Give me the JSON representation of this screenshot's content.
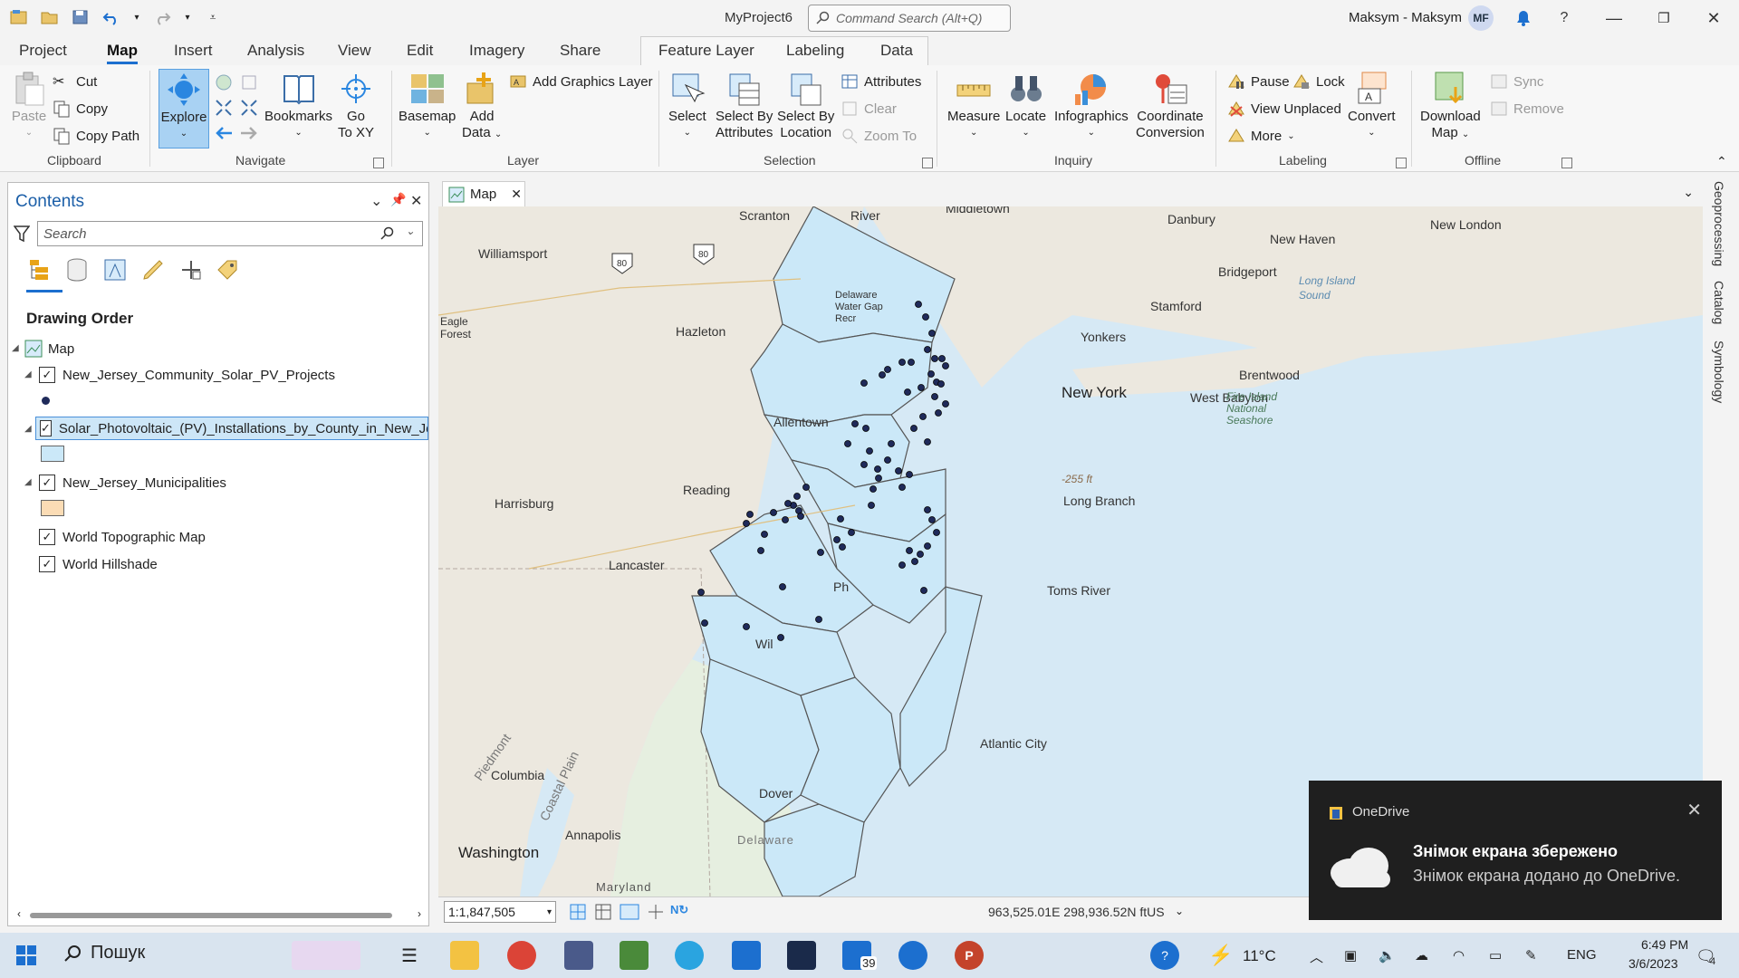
{
  "app": {
    "title": "MyProject6",
    "command_search_placeholder": "Command Search (Alt+Q)",
    "user_name": "Maksym - Maksym",
    "user_initials": "MF"
  },
  "tabs": [
    "Project",
    "Map",
    "Insert",
    "Analysis",
    "View",
    "Edit",
    "Imagery",
    "Share",
    "Feature Layer",
    "Labeling",
    "Data"
  ],
  "active_tab": "Map",
  "ribbon": {
    "clipboard": {
      "label": "Clipboard",
      "paste": "Paste",
      "cut": "Cut",
      "copy": "Copy",
      "copy_path": "Copy Path"
    },
    "navigate": {
      "label": "Navigate",
      "explore": "Explore",
      "bookmarks": "Bookmarks",
      "go_to_xy_1": "Go",
      "go_to_xy_2": "To XY"
    },
    "layer": {
      "label": "Layer",
      "basemap": "Basemap",
      "add_data_1": "Add",
      "add_data_2": "Data",
      "add_graphics_layer": "Add Graphics Layer"
    },
    "selection": {
      "label": "Selection",
      "select": "Select",
      "select_by_attr_1": "Select By",
      "select_by_attr_2": "Attributes",
      "select_by_loc_1": "Select By",
      "select_by_loc_2": "Location",
      "attributes": "Attributes",
      "clear": "Clear",
      "zoom_to": "Zoom To"
    },
    "inquiry": {
      "label": "Inquiry",
      "measure": "Measure",
      "locate": "Locate",
      "infographics": "Infographics",
      "coord_conv_1": "Coordinate",
      "coord_conv_2": "Conversion"
    },
    "labeling": {
      "label": "Labeling",
      "pause": "Pause",
      "lock": "Lock",
      "view_unplaced": "View Unplaced",
      "more": "More",
      "convert": "Convert"
    },
    "offline": {
      "label": "Offline",
      "download_1": "Download",
      "download_2": "Map",
      "sync": "Sync",
      "remove": "Remove"
    }
  },
  "contents": {
    "title": "Contents",
    "search_placeholder": "Search",
    "drawing_order": "Drawing Order",
    "map_node": "Map",
    "layers": [
      {
        "name": "New_Jersey_Community_Solar_PV_Projects",
        "checked": true,
        "swatch": "#1f2a5a"
      },
      {
        "name": "Solar_Photovoltaic_(PV)_Installations_by_County_in_New_Jersey",
        "checked": true,
        "swatch": "#cbe8f8",
        "selected": true
      },
      {
        "name": "New_Jersey_Municipalities",
        "checked": true,
        "swatch": "#fbdcb5"
      },
      {
        "name": "World Topographic Map",
        "checked": true
      },
      {
        "name": "World Hillshade",
        "checked": true
      }
    ]
  },
  "map": {
    "tab_label": "Map",
    "labels": {
      "scranton": "Scranton",
      "river": "River",
      "middletown": "Middletown",
      "danbury": "Danbury",
      "new_london": "New London",
      "new_haven": "New Haven",
      "williamsport": "Williamsport",
      "bridgeport": "Bridgeport",
      "long_island_sound": "Long Island Sound",
      "delaware_gap": "Delaware Water Gap Recr",
      "stamford": "Stamford",
      "hazleton": "Hazleton",
      "eagle_forest": "Eagle Forest",
      "yonkers": "Yonkers",
      "brentwood": "Brentwood",
      "new_york": "New York",
      "west_babylon": "West Babylon",
      "fire_island": "Fire Island National Seashore",
      "allentown": "Allentown",
      "reading": "Reading",
      "harrisburg": "Harrisburg",
      "long_branch": "Long Branch",
      "depth": "-255 ft",
      "lancaster": "Lancaster",
      "toms_river": "Toms River",
      "philadelphia": "Ph",
      "wilmington": "Wil",
      "atlantic_city": "Atlantic City",
      "piedmont": "Piedmont",
      "columbia": "Columbia",
      "coastal_plain": "Coastal Plain",
      "dover": "Dover",
      "annapolis": "Annapolis",
      "washington": "Washington",
      "delaware": "Delaware",
      "maryland": "Maryland",
      "i80a": "80",
      "i80b": "80"
    },
    "scale": "1:1,847,505",
    "coordinates": "963,525.01E 298,936.52N ftUS"
  },
  "side_dock": [
    "Geoprocessing",
    "Catalog",
    "Symbology"
  ],
  "toast": {
    "app": "OneDrive",
    "title": "Знімок екрана збережено",
    "body": "Знімок екрана додано до OneDrive."
  },
  "taskbar": {
    "search": "Пошук",
    "badge": "39",
    "temperature": "11°C",
    "language": "ENG",
    "time": "6:49 PM",
    "date": "3/6/2023",
    "notifications": "4"
  },
  "colors": {
    "accent": "#1c6fcf",
    "county_fill": "#cbe8f8",
    "point_fill": "#1f2a5a",
    "water": "#d6e9f5"
  }
}
